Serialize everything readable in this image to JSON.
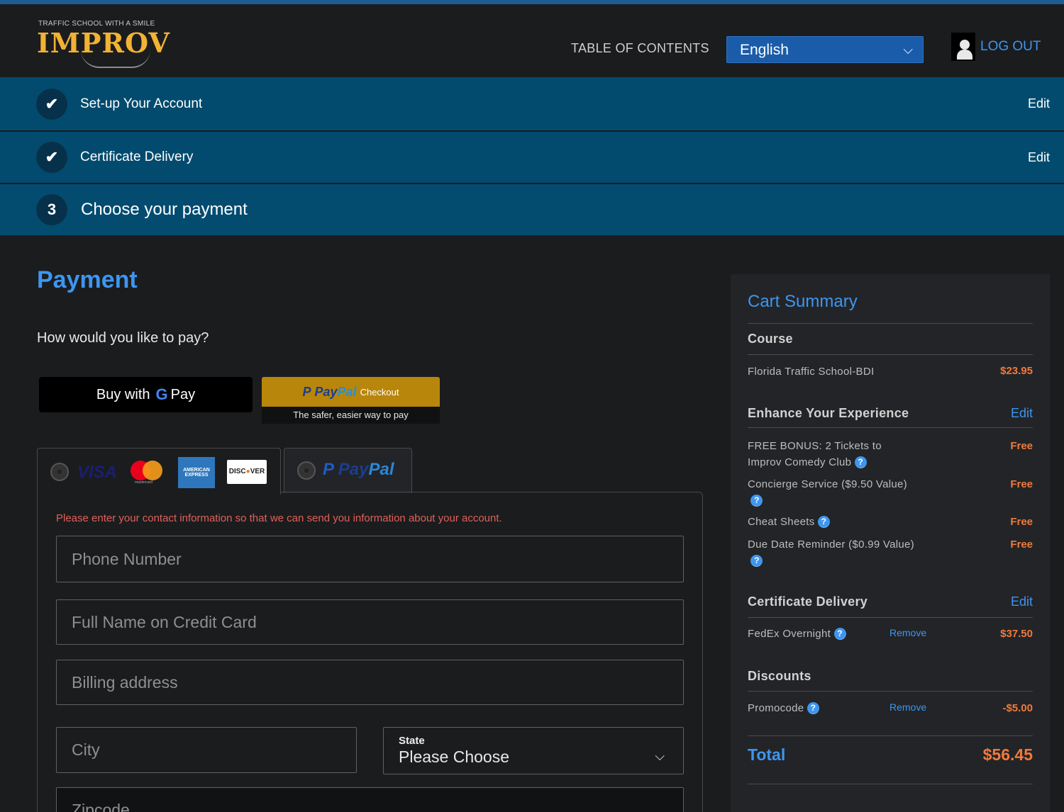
{
  "header": {
    "logo_tagline": "TRAFFIC SCHOOL WITH A SMILE",
    "logo_text": "IMPROV",
    "toc_label": "TABLE OF CONTENTS",
    "language_selected": "English",
    "logout_label": "LOG OUT"
  },
  "steps": [
    {
      "marker": "✔",
      "title": "Set-up Your Account",
      "edit": "Edit"
    },
    {
      "marker": "✔",
      "title": "Certificate Delivery",
      "edit": "Edit"
    },
    {
      "marker": "3",
      "title": "Choose your payment"
    }
  ],
  "payment": {
    "title": "Payment",
    "question": "How would you like to pay?",
    "gpay": {
      "pre": "Buy with",
      "g": "G",
      "post": "Pay"
    },
    "paypal_button": {
      "pay": "Pay",
      "pal": "Pal",
      "checkout": "Checkout",
      "tagline": "The safer, easier way to pay"
    },
    "card_brands": {
      "visa": "VISA",
      "mastercard": "mastercard",
      "amex": "AMERICAN EXPRESS",
      "discover_pre": "DISC",
      "discover_o": "●",
      "discover_post": "VER"
    },
    "paypal_tab": {
      "pay": "Pay",
      "pal": "Pal"
    },
    "notice": "Please enter your contact information so that we can send you information about your account.",
    "fields": {
      "phone": "Phone Number",
      "name": "Full Name on Credit Card",
      "address": "Billing address",
      "city": "City",
      "state_label": "State",
      "state_value": "Please Choose",
      "zip": "Zipcode"
    }
  },
  "cart": {
    "title": "Cart Summary",
    "course_header": "Course",
    "course": {
      "name": "Florida Traffic School-BDI",
      "price": "$23.95"
    },
    "enhance_header": "Enhance Your Experience",
    "enhance_edit": "Edit",
    "enhancements": [
      {
        "line1": "FREE BONUS: 2 Tickets to",
        "line2": "Improv Comedy Club",
        "price": "Free"
      },
      {
        "line1": "Concierge Service ($9.50 Value)",
        "price": "Free"
      },
      {
        "line1": "Cheat Sheets",
        "price": "Free"
      },
      {
        "line1": "Due Date Reminder ($0.99 Value)",
        "price": "Free"
      }
    ],
    "cert_header": "Certificate Delivery",
    "cert_edit": "Edit",
    "cert_item": {
      "name": "FedEx Overnight",
      "remove": "Remove",
      "price": "$37.50"
    },
    "discounts_header": "Discounts",
    "discount_item": {
      "name": "Promocode",
      "remove": "Remove",
      "price": "-$5.00"
    },
    "total_label": "Total",
    "total_value": "$56.45"
  },
  "colors": {
    "accent_blue": "#3d96f0",
    "step_bar": "#024b6e",
    "price_orange": "#f07a3b",
    "logo_gold": "#f2b233",
    "notice_red": "#e0605a"
  },
  "icons": {
    "check": "check-icon",
    "user": "user-icon",
    "chevron": "chevron-down-icon",
    "help": "question-circle-icon"
  }
}
